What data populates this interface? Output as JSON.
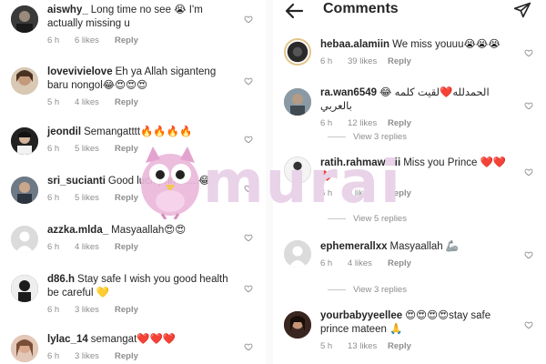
{
  "left": {
    "comments": [
      {
        "user": "aiswhy_",
        "text": "Long time no see 😭 I'm actually missing u",
        "time": "6 h",
        "likes": "6 likes",
        "reply": "Reply"
      },
      {
        "user": "lovevivielove",
        "text": "Eh ya Allah siganteng baru nongol😂😍😍😍",
        "time": "5 h",
        "likes": "4 likes",
        "reply": "Reply"
      },
      {
        "user": "jeondil",
        "text": "Semangatttt🔥🔥🔥🔥",
        "time": "6 h",
        "likes": "5 likes",
        "reply": "Reply"
      },
      {
        "user": "sri_sucianti",
        "text": "Good luck prince....😂",
        "time": "6 h",
        "likes": "5 likes",
        "reply": "Reply"
      },
      {
        "user": "azzka.mlda_",
        "text": "Masyaallah😍😍",
        "time": "6 h",
        "likes": "4 likes",
        "reply": "Reply"
      },
      {
        "user": "d86.h",
        "text": "Stay safe  I wish you good health be careful 💛",
        "time": "6 h",
        "likes": "3 likes",
        "reply": "Reply"
      },
      {
        "user": "lylac_14",
        "text": "semangat❤️❤️❤️",
        "time": "6 h",
        "likes": "3 likes",
        "reply": "Reply"
      }
    ]
  },
  "right": {
    "header": {
      "title": "Comments"
    },
    "comments": [
      {
        "user": "hebaa.alamiin",
        "text": "We miss youuu😭😭😭",
        "time": "6 h",
        "likes": "39 likes",
        "reply": "Reply"
      },
      {
        "user": "ra.wan6549",
        "text": "😂 الحمدلله❤️لقيت كلمه بالعربي",
        "time": "6 h",
        "likes": "12 likes",
        "reply": "Reply",
        "view_replies": "View 3 replies"
      },
      {
        "user": "ratih.rahmawatii",
        "text": "Miss you Prince ❤️❤️❤️",
        "time": "6 h",
        "likes": "7 likes",
        "reply": "Reply",
        "view_replies": "View 5 replies"
      },
      {
        "user": "ephemerallxx",
        "text": "Masyaallah 🦾",
        "time": "6 h",
        "likes": "4 likes",
        "reply": "Reply",
        "view_replies": "View 3 replies"
      },
      {
        "user": "yourbabyyeellee",
        "text": "😍😍😍😍stay safe prince mateen 🙏",
        "time": "5 h",
        "likes": "13 likes",
        "reply": "Reply"
      }
    ]
  },
  "watermark": {
    "word": "murai"
  },
  "colors": {
    "text": "#262626",
    "muted": "#8e8e8e",
    "watermark": "#e9d3e8"
  }
}
